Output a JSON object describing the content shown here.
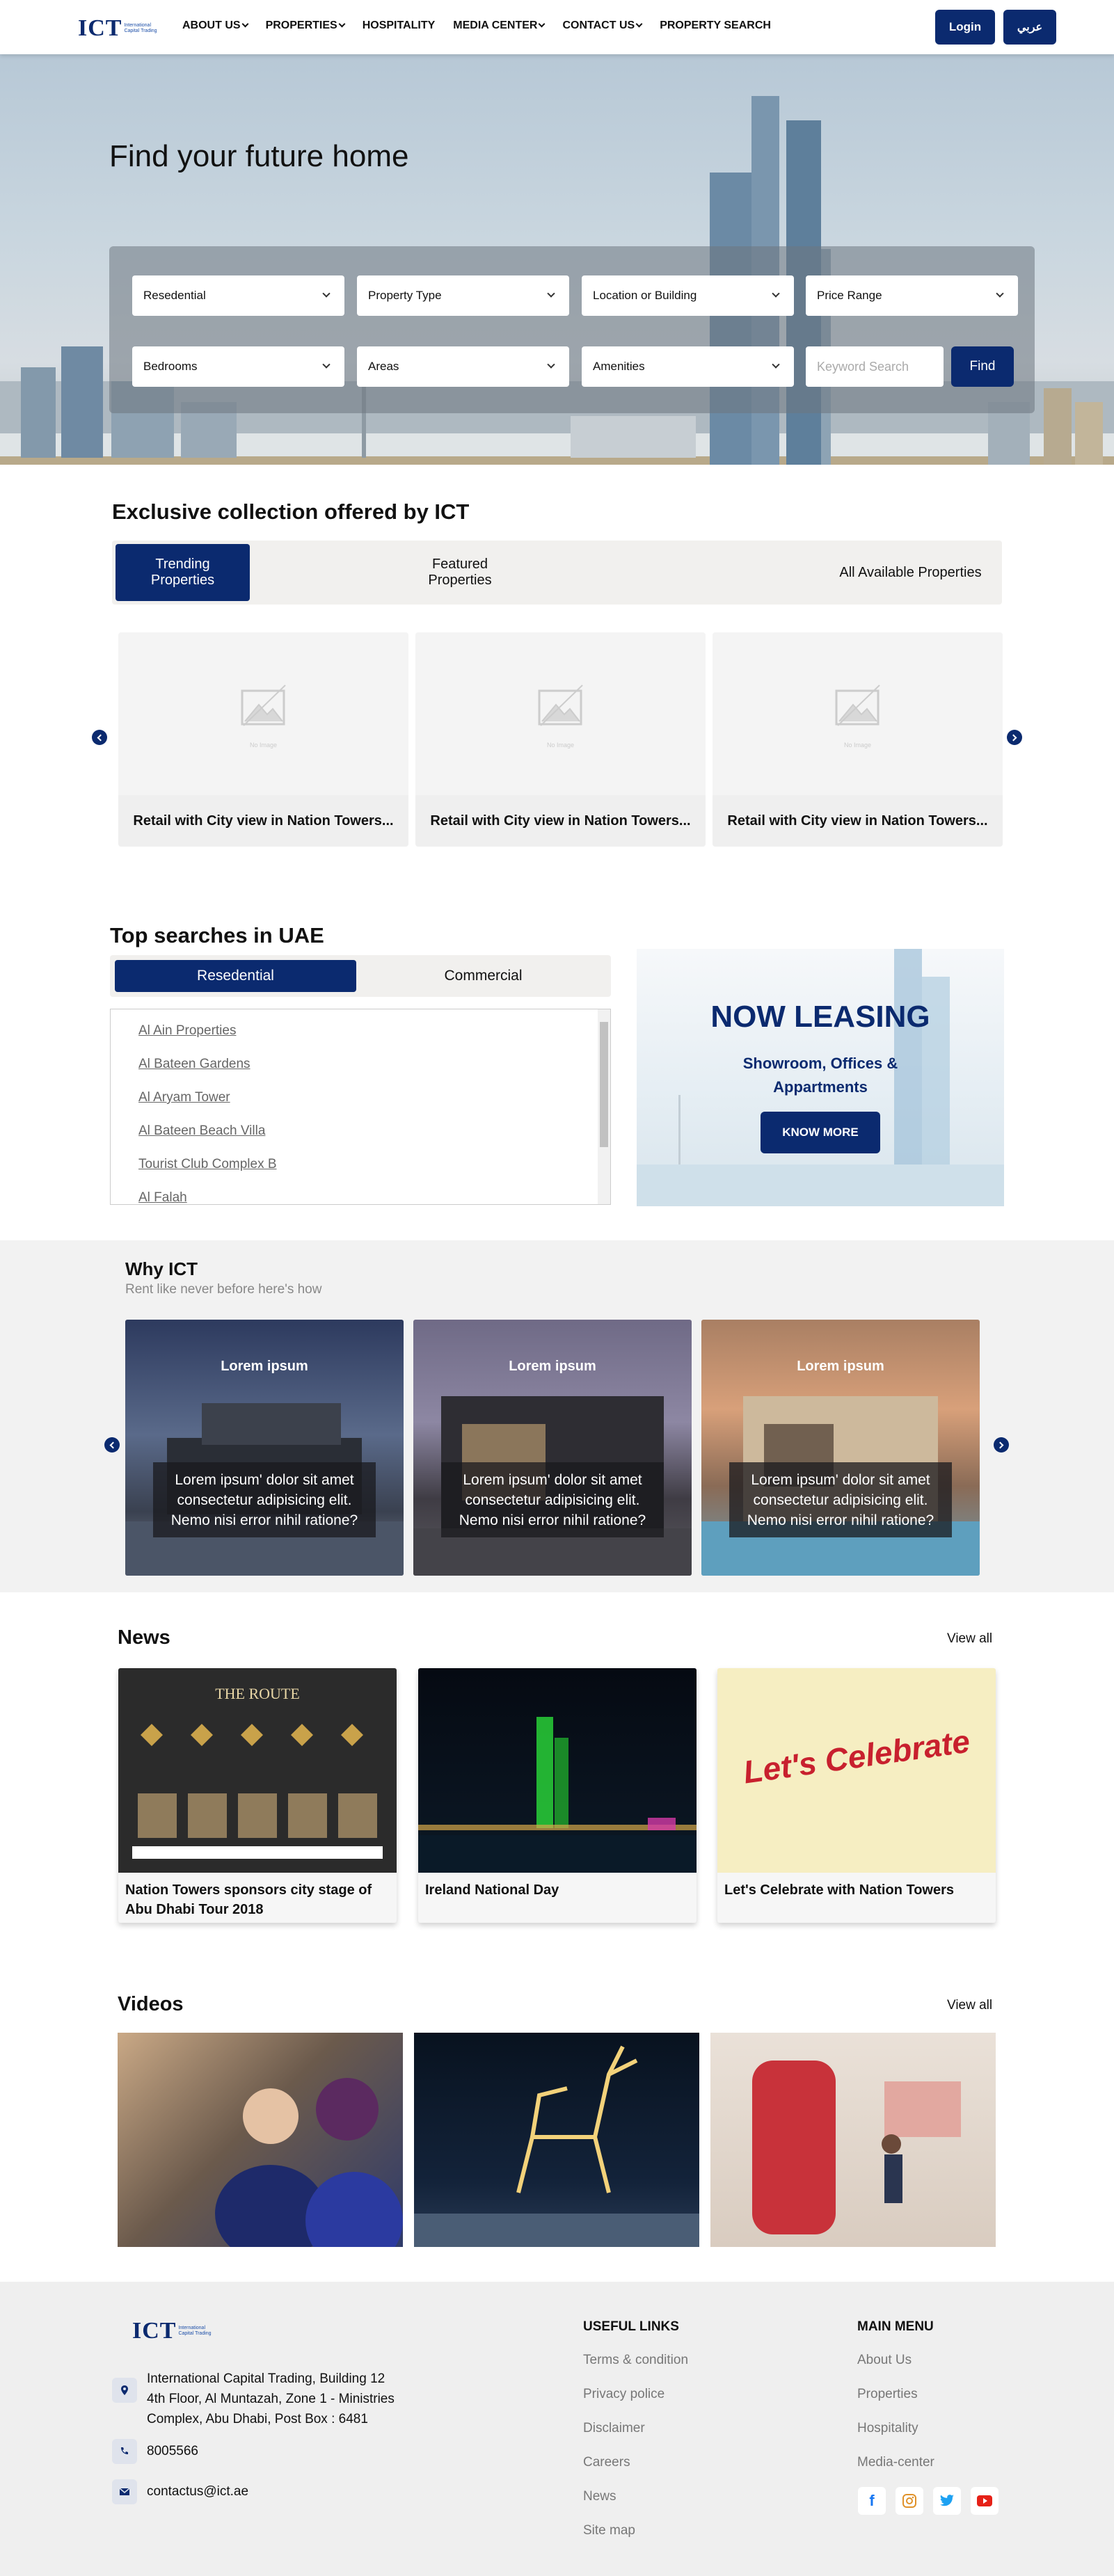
{
  "header": {
    "logo_text": "ICT",
    "logo_sub": "International Capital Trading",
    "nav": [
      "ABOUT US",
      "PROPERTIES",
      "HOSPITALITY",
      "MEDIA CENTER",
      "CONTACT US",
      "PROPERTY SEARCH"
    ],
    "login_label": "Login",
    "lang_label": "عربي"
  },
  "hero": {
    "title": "Find your future home",
    "fields_row1": [
      "Resedential",
      "Property Type",
      "Location or Building",
      "Price Range"
    ],
    "fields_row2": [
      "Bedrooms",
      "Areas",
      "Amenities"
    ],
    "keyword_placeholder": "Keyword Search",
    "find_label": "Find"
  },
  "exclusive": {
    "title": "Exclusive collection offered by ICT",
    "tabs": [
      "Trending Properties",
      "Featured Properties",
      "All Available Properties"
    ],
    "placeholder_label": "No Image",
    "cards": [
      {
        "title": "Retail with City view in Nation Towers..."
      },
      {
        "title": "Retail with City view in Nation Towers..."
      },
      {
        "title": "Retail with City view in Nation Towers..."
      }
    ]
  },
  "top_searches": {
    "title": "Top searches in UAE",
    "tabs": [
      "Resedential",
      "Commercial"
    ],
    "items": [
      "Al Ain Properties",
      "Al Bateen Gardens",
      "Al Aryam Tower",
      "Al Bateen Beach Villa",
      "Tourist Club Complex B",
      "Al Falah"
    ]
  },
  "leasing": {
    "title": "NOW LEASING",
    "subtitle": "Showroom, Offices & Appartments",
    "button": "KNOW MORE"
  },
  "why": {
    "title": "Why ICT",
    "subtitle": "Rent like never before here's how",
    "cards": [
      {
        "heading": "Lorem ipsum",
        "text": "Lorem ipsum' dolor sit amet consectetur adipisicing elit. Nemo nisi error nihil ratione?"
      },
      {
        "heading": "Lorem ipsum",
        "text": "Lorem ipsum' dolor sit amet consectetur adipisicing elit. Nemo nisi error nihil ratione?"
      },
      {
        "heading": "Lorem ipsum",
        "text": "Lorem ipsum' dolor sit amet consectetur adipisicing elit. Nemo nisi error nihil ratione?"
      }
    ]
  },
  "news": {
    "title": "News",
    "view_all": "View all",
    "items": [
      {
        "caption": "Nation Towers sponsors city stage of Abu Dhabi Tour 2018",
        "poster_title": "THE ROUTE"
      },
      {
        "caption": "Ireland National Day"
      },
      {
        "caption": "Let's Celebrate with Nation Towers",
        "poster_title": "Let's Celebrate"
      }
    ]
  },
  "videos": {
    "title": "Videos",
    "view_all": "View all"
  },
  "footer": {
    "address_lines": [
      "International Capital Trading, Building 12",
      "4th Floor, Al Muntazah, Zone 1 - Ministries",
      "Complex, Abu Dhabi, Post Box : 6481"
    ],
    "phone": "8005566",
    "email": "contactus@ict.ae",
    "useful_links_title": "USEFUL LINKS",
    "useful_links": [
      "Terms & condition",
      "Privacy police",
      "Disclaimer",
      "Careers",
      "News",
      "Site map"
    ],
    "main_menu_title": "MAIN MENU",
    "main_menu": [
      "About Us",
      "Properties",
      "Hospitality",
      "Media-center"
    ],
    "social": [
      "facebook-icon",
      "instagram-icon",
      "twitter-icon",
      "youtube-icon"
    ]
  },
  "colors": {
    "brand": "#0b2a6f",
    "panel": "#f1f0ee"
  }
}
